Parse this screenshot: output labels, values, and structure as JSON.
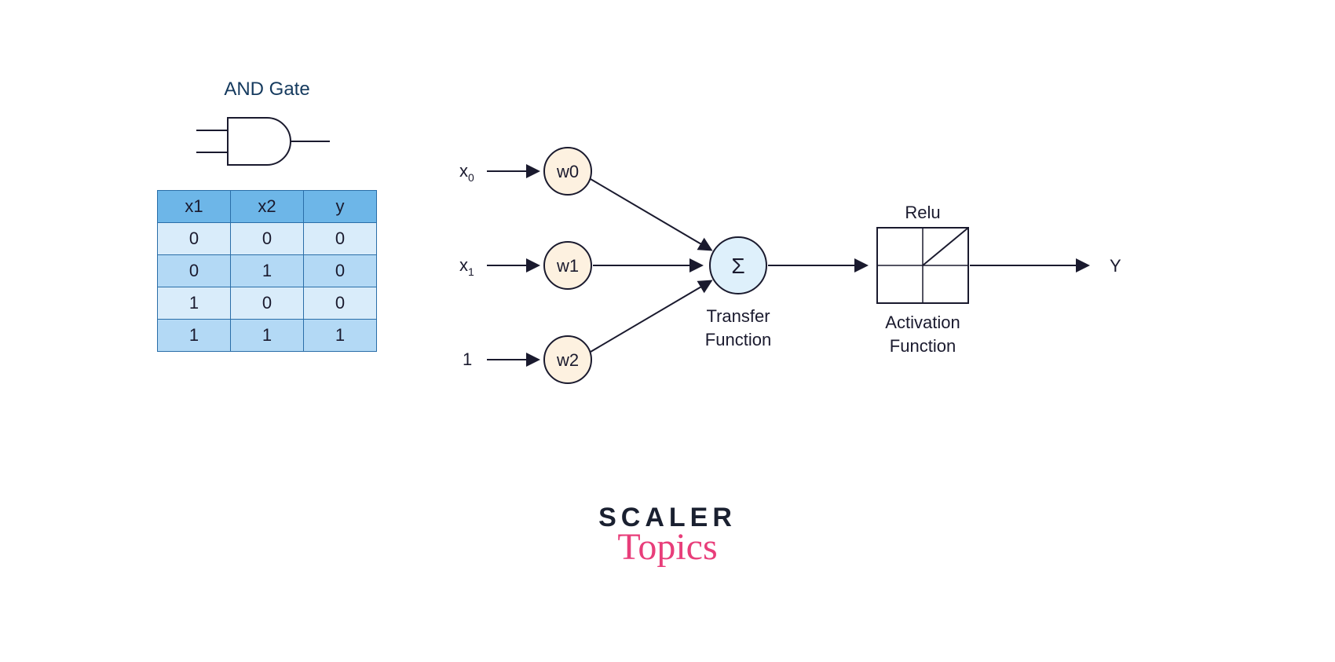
{
  "gate": {
    "title": "AND Gate"
  },
  "table": {
    "headers": [
      "x1",
      "x2",
      "y"
    ],
    "rows": [
      [
        "0",
        "0",
        "0"
      ],
      [
        "0",
        "1",
        "0"
      ],
      [
        "1",
        "0",
        "0"
      ],
      [
        "1",
        "1",
        "1"
      ]
    ]
  },
  "inputs": {
    "x0": "x",
    "x0_sub": "0",
    "x1": "x",
    "x1_sub": "1",
    "bias": "1"
  },
  "weights": {
    "w0": "w0",
    "w1": "w1",
    "w2": "w2"
  },
  "transfer": {
    "symbol": "Σ",
    "label_line1": "Transfer",
    "label_line2": "Function"
  },
  "activation": {
    "title": "Relu",
    "label_line1": "Activation",
    "label_line2": "Function"
  },
  "output": "Y",
  "logo": {
    "top": "SCALER",
    "bottom": "Topics"
  }
}
